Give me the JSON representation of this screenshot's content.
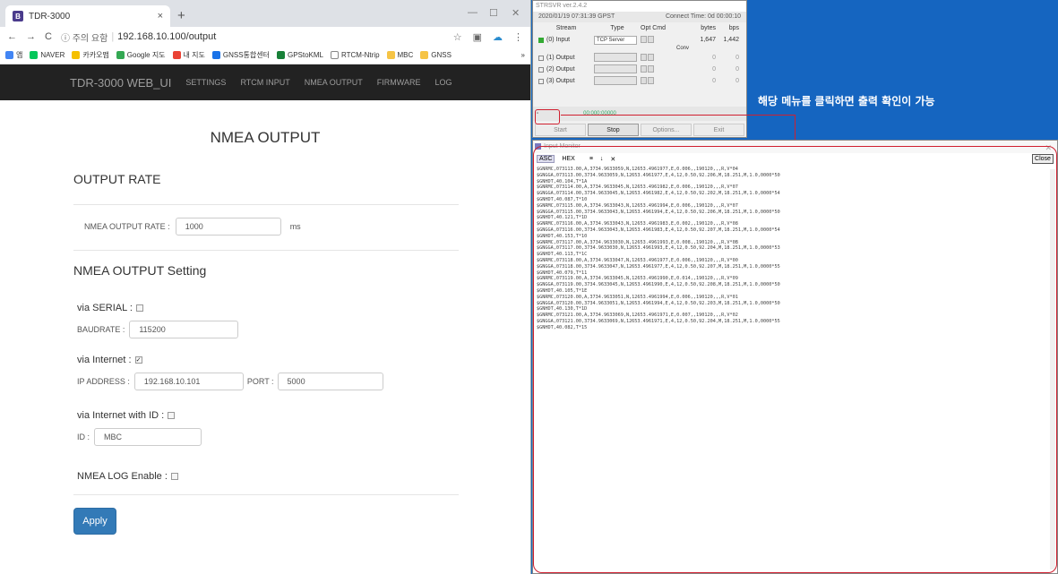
{
  "browser": {
    "tab_title": "TDR-3000",
    "tab_close": "×",
    "new_tab": "+",
    "nav_back": "←",
    "nav_forward": "→",
    "nav_reload": "C",
    "security_label": "ⓘ 주의 요함",
    "url": "192.168.10.100/output",
    "bookmarks": [
      "앱",
      "NAVER",
      "카카오맵",
      "Google 지도",
      "내 지도",
      "GNSS통합센터",
      "GPStoKML",
      "RTCM-Ntrip",
      "MBC",
      "GNSS"
    ],
    "bookmarks_more": "»"
  },
  "navbar": {
    "brand": "TDR-3000 WEB_UI",
    "links": [
      "SETTINGS",
      "RTCM INPUT",
      "NMEA OUTPUT",
      "FIRMWARE",
      "LOG"
    ]
  },
  "page": {
    "title": "NMEA OUTPUT",
    "output_rate": {
      "heading": "OUTPUT RATE",
      "label": "NMEA OUTPUT RATE :",
      "value": "1000",
      "unit": "ms"
    },
    "setting": {
      "heading": "NMEA OUTPUT Setting",
      "serial_label": "via SERIAL :",
      "serial_checked": false,
      "baudrate_label": "BAUDRATE :",
      "baudrate_value": "115200",
      "internet_label": "via Internet :",
      "internet_checked": true,
      "ip_label": "IP ADDRESS :",
      "ip_value": "192.168.10.101",
      "port_label": "PORT :",
      "port_value": "5000",
      "internet_id_label": "via Internet with ID :",
      "internet_id_checked": false,
      "id_label": "ID :",
      "id_value": "MBC",
      "log_label": "NMEA LOG Enable :",
      "log_checked": false
    },
    "apply_label": "Apply"
  },
  "strsvr": {
    "title": "STRSVR ver.2.4.2",
    "datetime": "2020/01/19 07:31:39 GPST",
    "connect_time": "Connect Time:   0d 00:00:10",
    "headers": {
      "stream": "Stream",
      "type": "Type",
      "opt": "Opt Cmd",
      "conv": "Conv",
      "bytes": "bytes",
      "bps": "bps"
    },
    "rows": [
      {
        "name": "(0) Input",
        "type": "TCP Server",
        "bytes": "1,647",
        "bps": "1,442",
        "active": true
      },
      {
        "name": "(1) Output",
        "type": "",
        "bytes": "0",
        "bps": "0",
        "active": false
      },
      {
        "name": "(2) Output",
        "type": "",
        "bytes": "0",
        "bps": "0",
        "active": false
      },
      {
        "name": "(3) Output",
        "type": "",
        "bytes": "0",
        "bps": "0",
        "active": false
      }
    ],
    "progress_text": "00:000:00000",
    "buttons": [
      "Start",
      "Stop",
      "Options...",
      "Exit"
    ]
  },
  "annotation": "해당 메뉴를 클릭하면 출력 확인이 가능",
  "monitor": {
    "title": "Input Monitor",
    "mode_asc": "ASC",
    "mode_hex": "HEX",
    "tools": [
      "≡",
      "↓",
      "✕"
    ],
    "close_label": "Close",
    "lines": [
      "$GNRMC,073113.00,A,3734.9633059,N,12653.4961977,E,0.006,,190120,,,R,V*04",
      "$GNGGA,073113.00,3734.9633059,N,12653.4961977,E,4,12,0.50,92.206,M,18.251,M,1.0,0000*50",
      "$GNHDT,40.104,T*1A",
      "$GNRMC,073114.00,A,3734.9633045,N,12653.4961982,E,0.006,,190120,,,R,V*07",
      "$GNGGA,073114.00,3734.9633045,N,12653.4961982,E,4,12,0.50,92.202,M,18.251,M,1.0,0000*54",
      "$GNHDT,40.087,T*10",
      "$GNRMC,073115.00,A,3734.9633043,N,12653.4961994,E,0.006,,190120,,,R,V*07",
      "$GNGGA,073115.00,3734.9633043,N,12653.4961994,E,4,12,0.50,92.206,M,18.251,M,1.0,0000*50",
      "$GNHDT,40.121,T*1D",
      "$GNRMC,073116.00,A,3734.9633043,N,12653.4961983,E,0.002,,190120,,,R,V*08",
      "$GNGGA,073116.00,3734.9633043,N,12653.4961983,E,4,12,0.50,92.207,M,18.251,M,1.0,0000*54",
      "$GNHDT,40.153,T*10",
      "$GNRMC,073117.00,A,3734.9633030,N,12653.4961993,E,0.008,,190120,,,R,V*0B",
      "$GNGGA,073117.00,3734.9633030,N,12653.4961993,E,4,12,0.50,92.204,M,18.251,M,1.0,0000*53",
      "$GNHDT,40.113,T*1C",
      "$GNRMC,073118.00,A,3734.9633047,N,12653.4961977,E,0.006,,190120,,,R,V*00",
      "$GNGGA,073118.00,3734.9633047,N,12653.4961977,E,4,12,0.50,92.207,M,18.251,M,1.0,0000*55",
      "$GNHDT,40.079,T*11",
      "$GNRMC,073119.00,A,3734.9633045,N,12653.4961990,E,0.014,,190120,,,R,V*09",
      "$GNGGA,073119.00,3734.9633045,N,12653.4961990,E,4,12,0.50,92.208,M,18.251,M,1.0,0000*50",
      "$GNHDT,40.105,T*1E",
      "$GNRMC,073120.00,A,3734.9633051,N,12653.4961994,E,0.006,,190120,,,R,V*01",
      "$GNGGA,073120.00,3734.9633051,N,12653.4961994,E,4,12,0.50,92.203,M,18.251,M,1.0,0000*50",
      "$GNHDT,40.130,T*1D",
      "$GNRMC,073121.00,A,3734.9633069,N,12653.4961971,E,0.007,,190120,,,R,V*02",
      "$GNGGA,073121.00,3734.9633069,N,12653.4961971,E,4,12,0.50,92.204,M,18.251,M,1.0,0000*55",
      "$GNHDT,40.082,T*15"
    ]
  },
  "colors": {
    "desktop": "#1565c0",
    "navbar": "#222222",
    "apply": "#337ab7",
    "highlight": "#d02030"
  }
}
